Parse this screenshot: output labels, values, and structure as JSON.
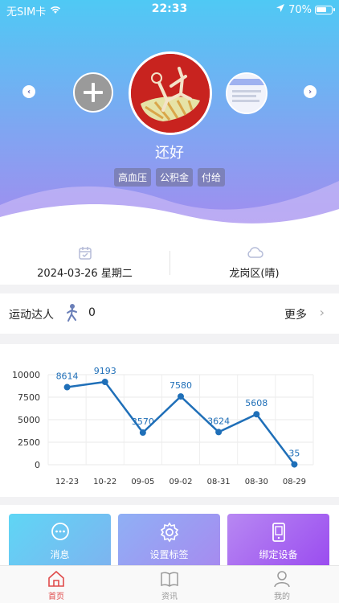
{
  "status": {
    "carrier": "无SIM卡",
    "time": "22:33",
    "battery": "70%",
    "battery_level": 0.7
  },
  "profile": {
    "name": "还好",
    "tags": [
      "高血压",
      "公积金",
      "付给"
    ]
  },
  "info": {
    "date": "2024-03-26 星期二",
    "weather": "龙岗区(晴)"
  },
  "sport": {
    "label": "运动达人",
    "count": "0",
    "more": "更多"
  },
  "chart_data": {
    "type": "line",
    "categories": [
      "12-23",
      "10-22",
      "09-05",
      "09-02",
      "08-31",
      "08-30",
      "08-29"
    ],
    "values": [
      8614,
      9193,
      3570,
      7580,
      3624,
      5608,
      35
    ],
    "yticks": [
      0,
      2500,
      5000,
      7500,
      10000
    ],
    "ylim": [
      0,
      10000
    ],
    "grid": true,
    "color": "#1f6fb8"
  },
  "tiles": [
    {
      "label": "消息",
      "icon": "message-icon"
    },
    {
      "label": "设置标签",
      "icon": "settings-icon"
    },
    {
      "label": "绑定设备",
      "icon": "device-icon"
    }
  ],
  "tabs": [
    {
      "label": "首页",
      "icon": "home-icon",
      "active": true
    },
    {
      "label": "资讯",
      "icon": "book-icon",
      "active": false
    },
    {
      "label": "我的",
      "icon": "user-icon",
      "active": false
    }
  ]
}
